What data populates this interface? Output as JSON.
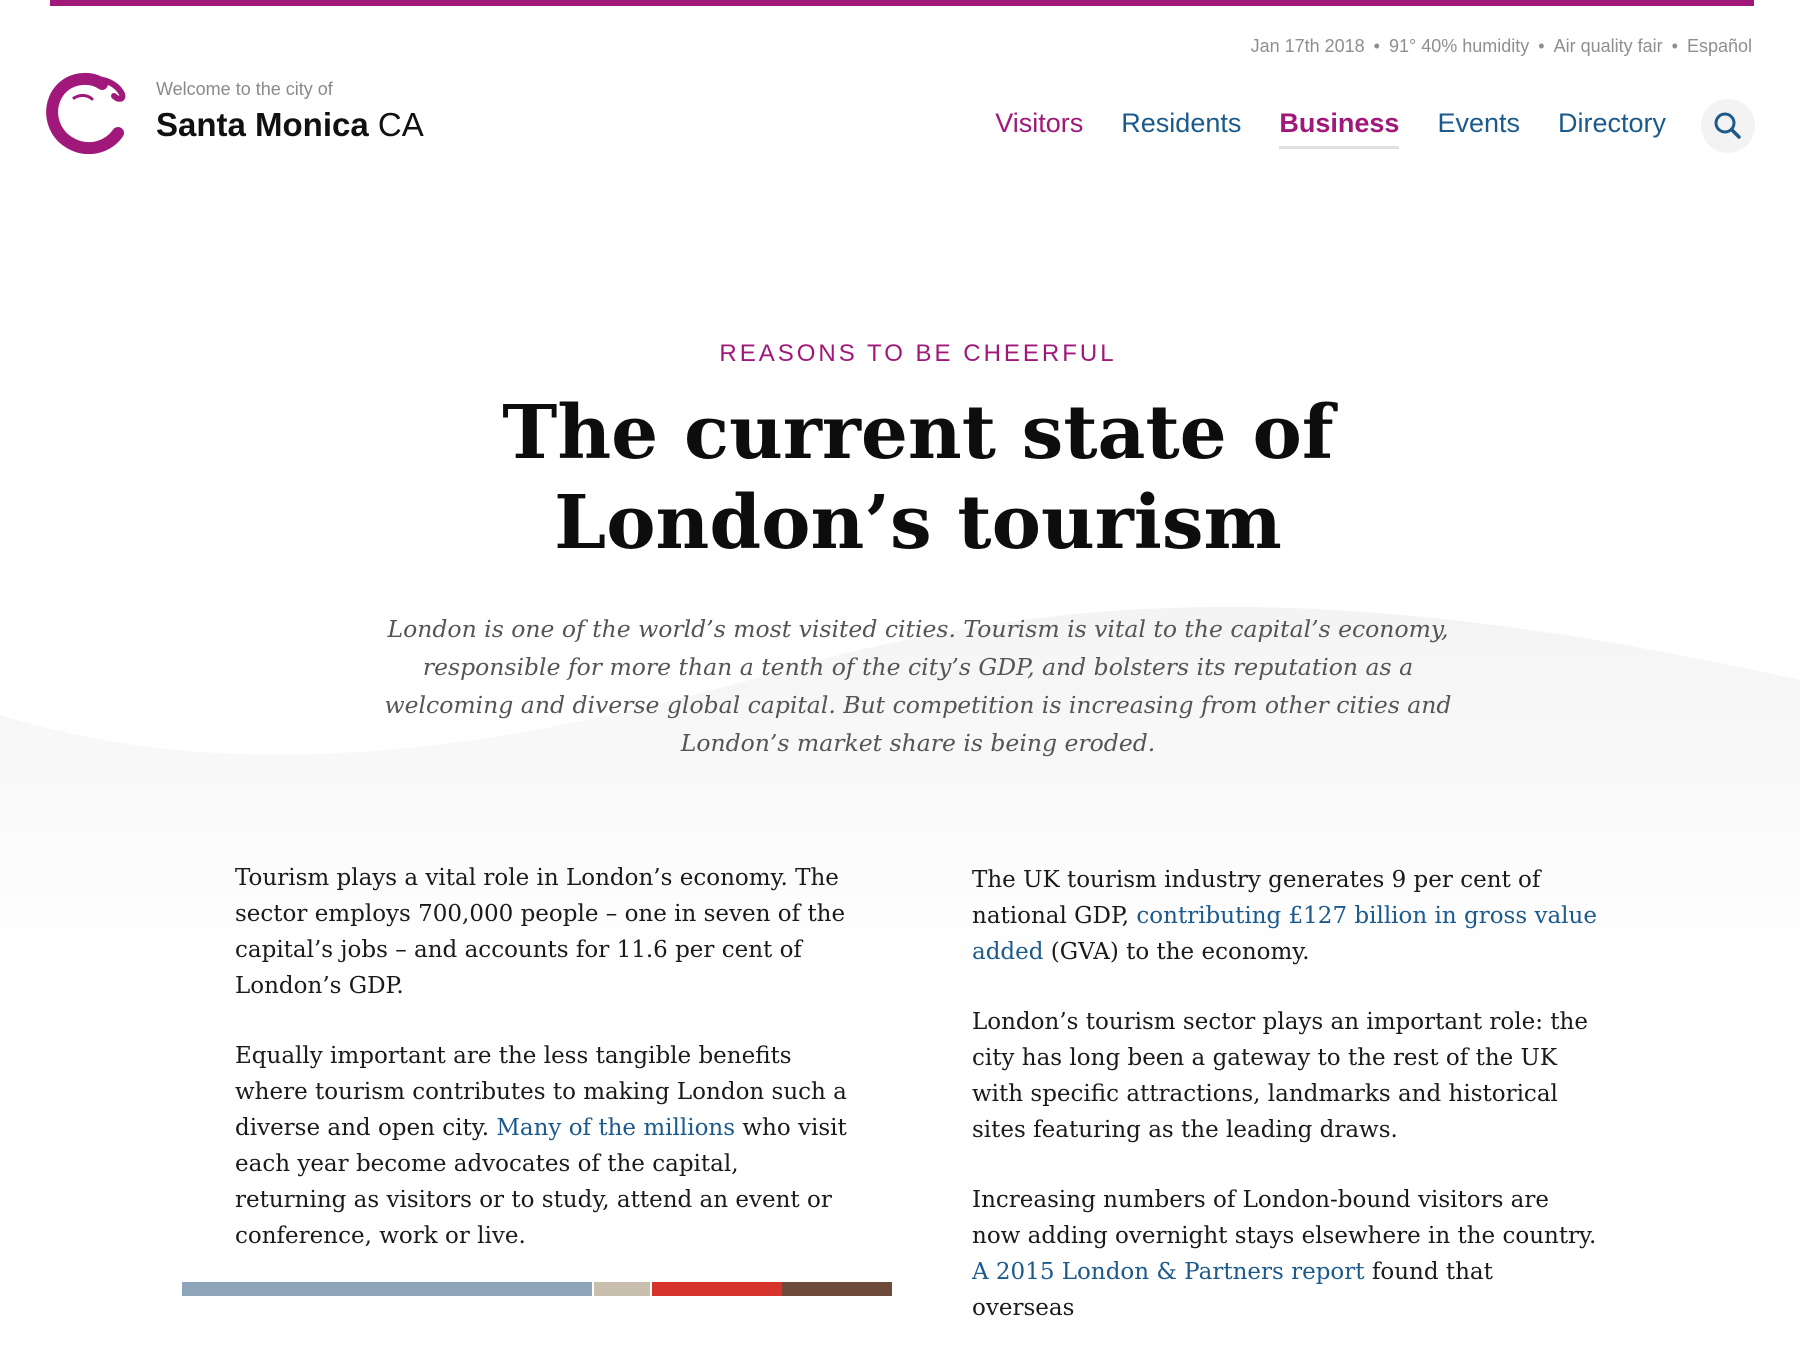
{
  "utility": {
    "date": "Jan 17th 2018",
    "weather": "91° 40% humidity",
    "air": "Air quality fair",
    "language": "Español"
  },
  "brand": {
    "welcome": "Welcome to the city of",
    "city": "Santa Monica",
    "state": "CA",
    "logo_color": "#a0187a"
  },
  "nav": {
    "items": [
      {
        "label": "Visitors"
      },
      {
        "label": "Residents"
      },
      {
        "label": "Business"
      },
      {
        "label": "Events"
      },
      {
        "label": "Directory"
      }
    ],
    "active": "Business",
    "search_icon": "search-icon"
  },
  "article": {
    "kicker": "REASONS TO BE CHEERFUL",
    "title_line1": "The current state of",
    "title_line2": "London’s tourism",
    "standfirst": "London is one of the world’s most visited cities. Tourism is vital to the capital’s economy, responsible for more than a tenth of the city’s GDP, and bolsters its reputation as a welcoming and diverse global capital. But competition is increasing from other cities and London’s market share is being eroded.",
    "left": {
      "p1": "Tourism plays a vital role in London’s economy. The sector employs 700,000 people – one in seven of the capital’s jobs – and accounts for 11.6 per cent of London’s GDP.",
      "p2_before": "Equally important are the less tangible benefits where tourism contributes to making London such a diverse and open city. ",
      "p2_link": "Many of the millions",
      "p2_after": " who visit each year become advocates of the capital, returning as visitors or to study, attend an event or conference, work or live."
    },
    "right": {
      "p1_before": "The UK tourism industry generates 9 per cent of national GDP, ",
      "p1_link": "contributing £127 billion in gross value added",
      "p1_after": " (GVA) to the economy.",
      "p2": "London’s tourism sector plays an important role: the city has long been a gateway to the rest of the UK with specific attractions, landmarks and historical sites featuring as the leading draws.",
      "p3_before": "Increasing numbers of London-bound visitors are now adding overnight stays elsewhere in the country. ",
      "p3_link": "A 2015 London & Partners report",
      "p3_after": " found that overseas"
    }
  },
  "colors": {
    "accent": "#a0187a",
    "link": "#1c5a8c",
    "text": "#1a1a1a",
    "muted": "#8f8f8f"
  }
}
